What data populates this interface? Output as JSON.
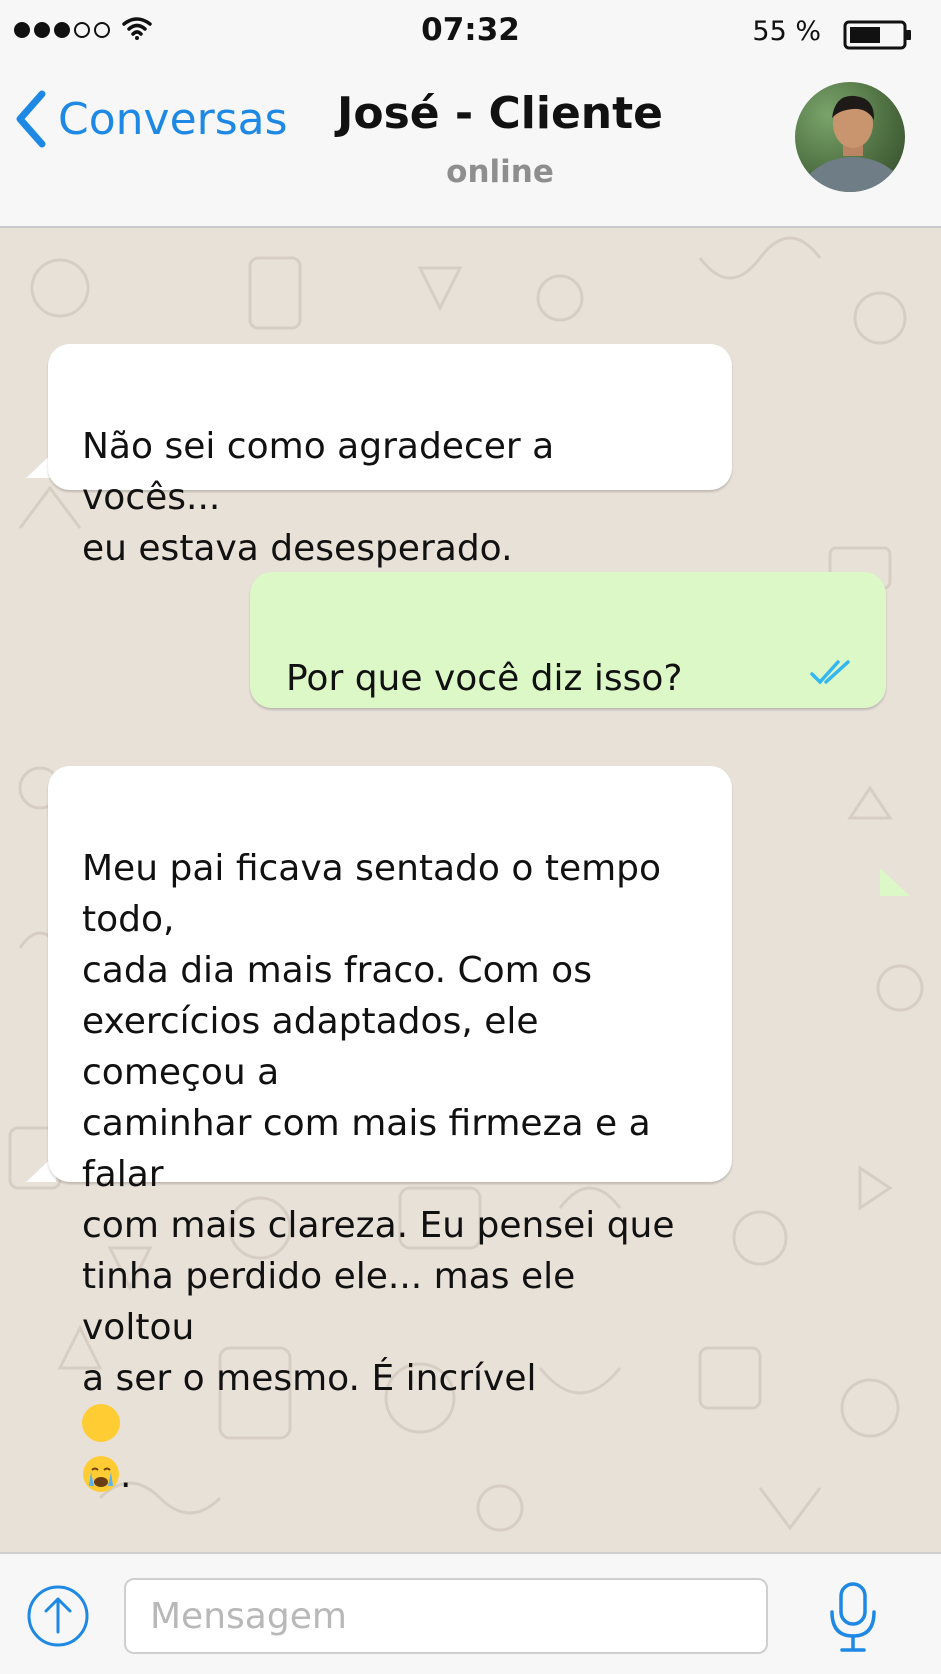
{
  "status_bar": {
    "time": "07:32",
    "battery_percent": "55 %",
    "signal_bars_filled": 3,
    "signal_bars_total": 5
  },
  "header": {
    "back_label": "Conversas",
    "contact_name": "José - Cliente",
    "contact_status": "online"
  },
  "messages": [
    {
      "direction": "incoming",
      "text": "Não sei como agradecer a vocês...\neu estava desesperado."
    },
    {
      "direction": "outgoing",
      "text": "Por que você diz isso?",
      "status_icon": "double-check-icon"
    },
    {
      "direction": "incoming",
      "text": "Meu pai ficava sentado o tempo todo,\ncada dia mais fraco. Com os\nexercícios adaptados, ele começou a\ncaminhar com mais firmeza e a falar\ncom mais clareza. Eu pensei que\ntinha perdido ele... mas ele voltou\na ser o mesmo. É incrível",
      "trailing_emoji": "crying-face-emoji",
      "trailing_text": "."
    }
  ],
  "input": {
    "placeholder": "Mensagem"
  },
  "colors": {
    "accent": "#1e88e5",
    "outgoing_bubble": "#dcf8c6",
    "incoming_bubble": "#ffffff",
    "chat_background": "#e8e1d8",
    "ticks": "#34b7f1"
  }
}
